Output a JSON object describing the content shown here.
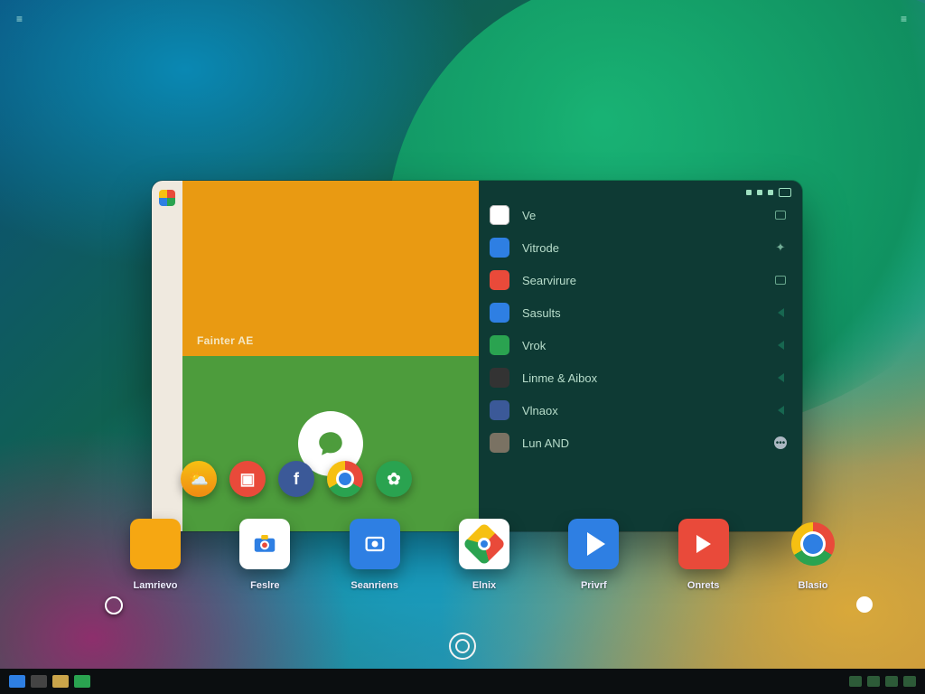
{
  "corners": {
    "left_marker": "≡",
    "right_marker": "≡"
  },
  "launcher": {
    "tile_top_caption": "Fainter AE",
    "list": [
      {
        "label": "Ve",
        "color": "#ffffff",
        "icon_name": "browser-icon",
        "tail": "box"
      },
      {
        "label": "Vitrode",
        "color": "#2e7fe3",
        "icon_name": "doc-icon",
        "tail": "spark"
      },
      {
        "label": "Searvirure",
        "color": "#e94a3a",
        "icon_name": "mail-icon",
        "tail": "box"
      },
      {
        "label": "Sasults",
        "color": "#2e7fe3",
        "icon_name": "search-icon",
        "tail": "arrow"
      },
      {
        "label": "Vrok",
        "color": "#2aa350",
        "icon_name": "chat-icon",
        "tail": "arrow"
      },
      {
        "label": "Linme & Aibox",
        "color": "#333333",
        "icon_name": "folder-icon",
        "tail": "arrow"
      },
      {
        "label": "Vlnaox",
        "color": "#3b5998",
        "icon_name": "social-icon",
        "tail": "arrow"
      },
      {
        "label": "Lun AND",
        "color": "#7a7263",
        "icon_name": "text-icon",
        "tail": "dot"
      }
    ]
  },
  "float_row": [
    {
      "name": "weather-icon",
      "bg": "linear-gradient(#f6c012,#f08a12)",
      "glyph": "⛅"
    },
    {
      "name": "video-icon",
      "bg": "#e94a3a",
      "glyph": "▣"
    },
    {
      "name": "facebook-icon",
      "bg": "#3b5998",
      "glyph": "f"
    },
    {
      "name": "chrome-icon",
      "bg": "",
      "glyph": ""
    },
    {
      "name": "leaf-icon",
      "bg": "#2aa350",
      "glyph": "✿"
    }
  ],
  "dock": [
    {
      "name": "Lamrievo",
      "icon_name": "windows-tile-icon",
      "style": "background:#f6a712"
    },
    {
      "name": "Feslre",
      "icon_name": "camera-icon",
      "style": "background:#fff"
    },
    {
      "name": "Seanriens",
      "icon_name": "video-app-icon",
      "style": "background:#2e7fe3"
    },
    {
      "name": "Elnix",
      "icon_name": "diamond-icon",
      "style": "background:#fff"
    },
    {
      "name": "Privrf",
      "icon_name": "play-icon",
      "style": "background:#2e7fe3"
    },
    {
      "name": "Onrets",
      "icon_name": "youtube-icon",
      "style": "background:#e94a3a"
    },
    {
      "name": "Blasio",
      "icon_name": "chrome-app-icon",
      "style": ""
    }
  ],
  "taskbar": {
    "left_icons": [
      "start-button",
      "search-icon",
      "folder-icon",
      "app-icon"
    ],
    "right_icons": [
      "net-icon",
      "vol-icon",
      "batt-icon",
      "clock-icon"
    ]
  }
}
